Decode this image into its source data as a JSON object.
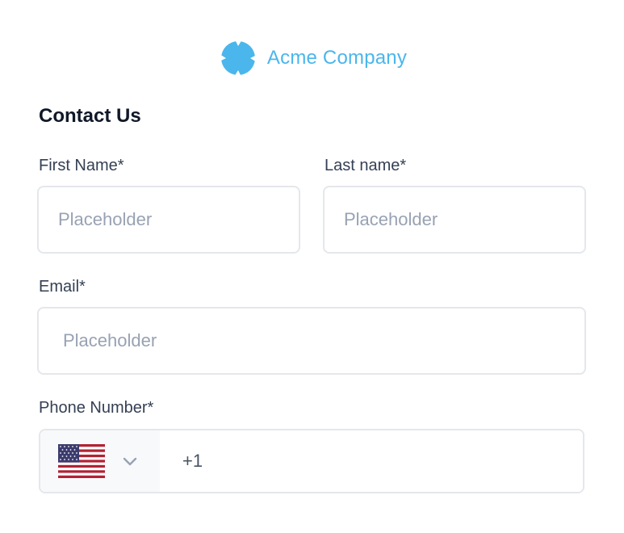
{
  "brand": {
    "logo_icon": "acme-logo-icon",
    "name": "Acme Company",
    "color": "#4ab6ec"
  },
  "form": {
    "title": "Contact Us",
    "first_name": {
      "label": "First Name*",
      "placeholder": "Placeholder",
      "value": ""
    },
    "last_name": {
      "label": "Last name*",
      "placeholder": "Placeholder",
      "value": ""
    },
    "email": {
      "label": "Email*",
      "placeholder": "Placeholder",
      "value": ""
    },
    "phone": {
      "label": "Phone Number*",
      "country_flag_icon": "us-flag-icon",
      "dropdown_icon": "chevron-down-icon",
      "prefix": "+1"
    }
  },
  "colors": {
    "text_primary": "#101828",
    "label": "#344054",
    "placeholder": "#98a2b3",
    "border": "#e4e7ec"
  }
}
